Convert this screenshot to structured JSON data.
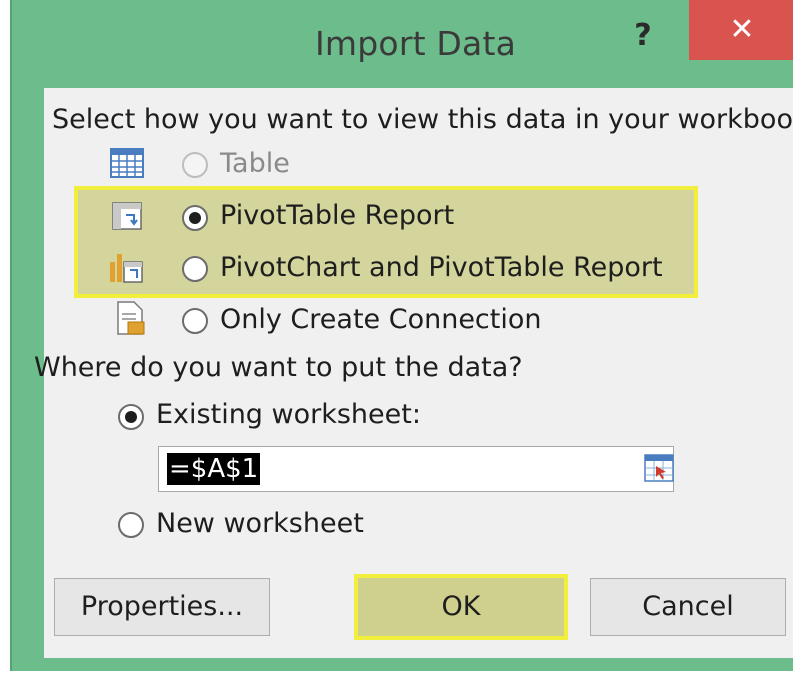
{
  "dialog": {
    "title": "Import Data",
    "help_label": "?",
    "close_label": "✕"
  },
  "view_section": {
    "prompt": "Select how you want to view this data in your workbook.",
    "options": [
      {
        "label": "Table",
        "icon": "table-icon",
        "selected": false,
        "enabled": false
      },
      {
        "label": "PivotTable Report",
        "icon": "pivottable-icon",
        "selected": true,
        "enabled": true
      },
      {
        "label": "PivotChart and PivotTable Report",
        "icon": "pivotchart-icon",
        "selected": false,
        "enabled": true
      },
      {
        "label": "Only Create Connection",
        "icon": "connection-icon",
        "selected": false,
        "enabled": true
      }
    ]
  },
  "location_section": {
    "prompt": "Where do you want to put the data?",
    "existing_label": "Existing worksheet:",
    "existing_selected": true,
    "reference_value": "=$A$1",
    "new_label": "New worksheet",
    "new_selected": false
  },
  "buttons": {
    "properties": "Properties...",
    "ok": "OK",
    "cancel": "Cancel"
  },
  "colors": {
    "frame": "#6dbd8c",
    "close": "#d9534f",
    "highlight_border": "#f2ee3c",
    "highlight_fill": "#bebe5a"
  }
}
